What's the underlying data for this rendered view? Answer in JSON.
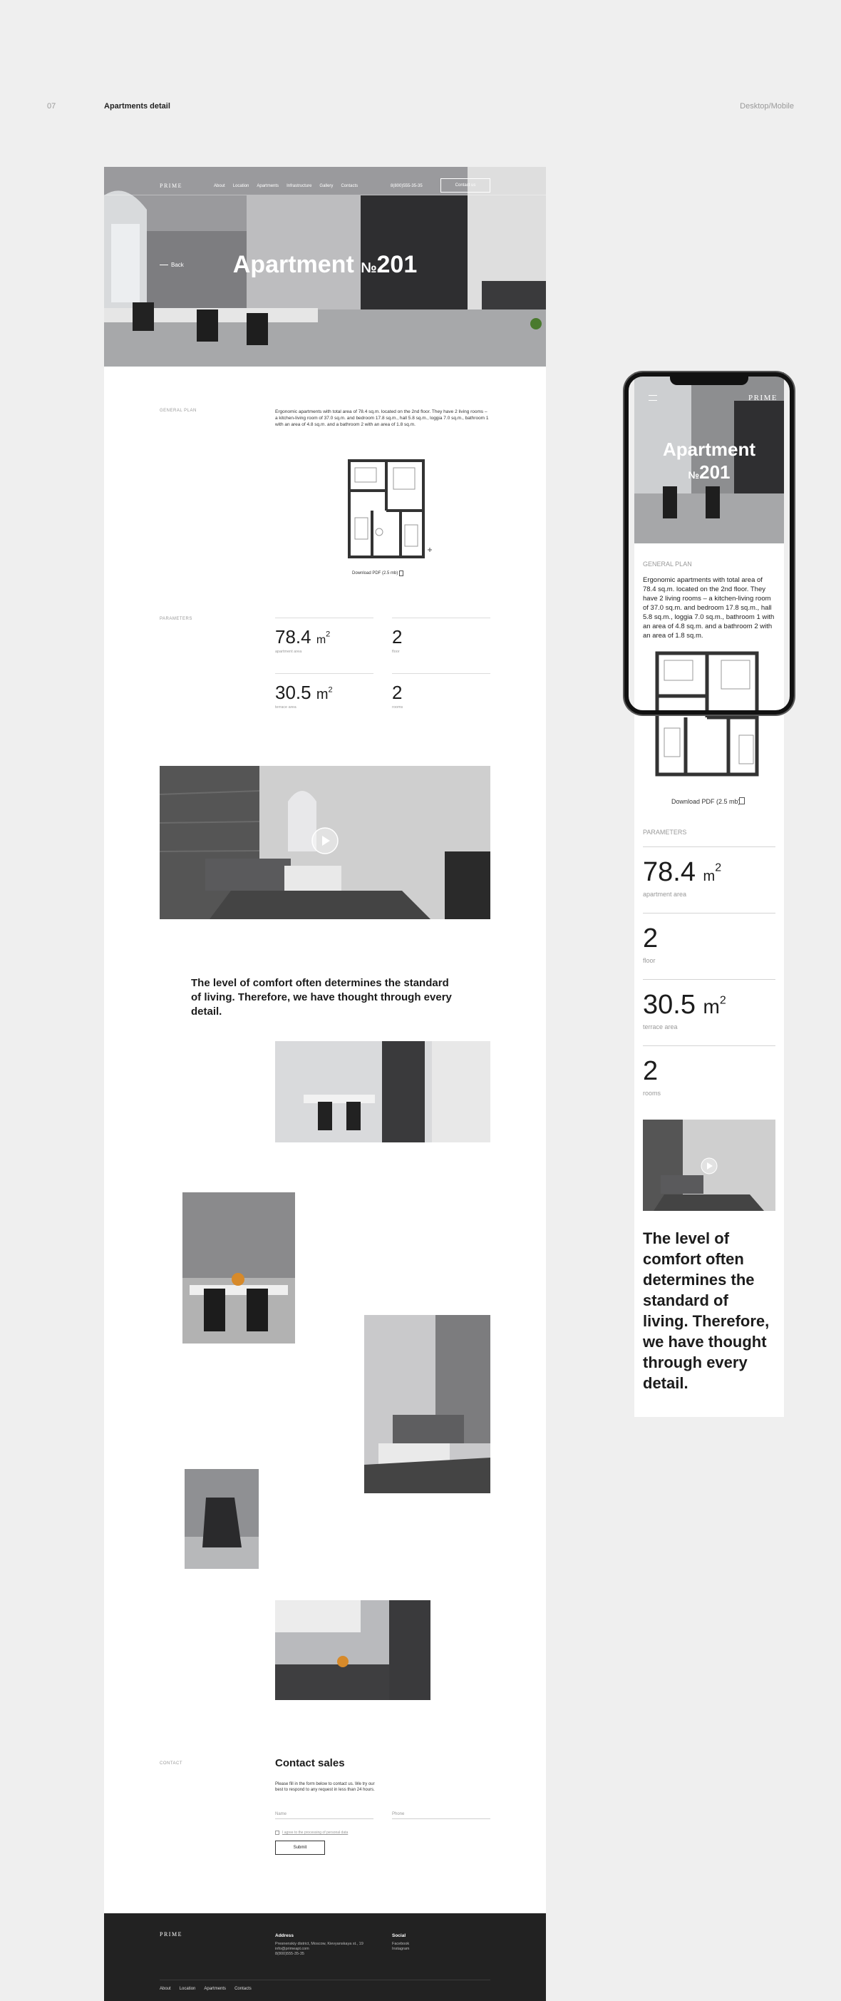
{
  "page": {
    "number": "07",
    "title": "Apartments detail",
    "mode": "Desktop/Mobile"
  },
  "nav": {
    "logo": "PRIME",
    "links": [
      "About",
      "Location",
      "Apartments",
      "Infrastructure",
      "Gallery",
      "Contacts"
    ],
    "phone": "8(800)555-35-35",
    "contact_button": "Contact us"
  },
  "hero": {
    "back": "Back",
    "title": "Apartment ",
    "number_sign": "№",
    "number": "201"
  },
  "plan": {
    "label": "GENERAL PLAN",
    "description": "Ergonomic apartments with total area of 78.4 sq.m. located on the 2nd floor. They have 2 living rooms – a kitchen-living room of 37.0 sq.m. and bedroom 17.8 sq.m., hall 5.8 sq.m., loggia 7.0 sq.m., bathroom 1 with an area of 4.8 sq.m. and a bathroom 2 with an area of 1.8 sq.m.",
    "download": "Download PDF (2.5 mb)"
  },
  "params": {
    "label": "PARAMETERS",
    "items": [
      {
        "value": "78.4",
        "unit": "m",
        "sup": "2",
        "caption": "apartment area"
      },
      {
        "value": "2",
        "unit": "",
        "sup": "",
        "caption": "floor"
      },
      {
        "value": "30.5",
        "unit": "m",
        "sup": "2",
        "caption": "terrace area"
      },
      {
        "value": "2",
        "unit": "",
        "sup": "",
        "caption": "rooms"
      }
    ]
  },
  "quote": "The level of comfort often determines the standard of living. Therefore, we have thought through every detail.",
  "contact": {
    "label": "CONTACT",
    "title": "Contact sales",
    "text": "Please fill in the form below to contact us. We try our best to respond to any request in less than 24 hours.",
    "name_placeholder": "Name",
    "phone_placeholder": "Phone",
    "consent": "I agree to the processing of personal data",
    "submit": "Submit"
  },
  "footer": {
    "logo": "PRIME",
    "address_title": "Address",
    "address_lines": [
      "Presnenskiy district, Moscow, Kievyanskaya st., 19",
      "info@primeapt.com",
      "8(800)555-35-35"
    ],
    "social_title": "Social",
    "social": [
      "Facebook",
      "Instagram"
    ],
    "nav": [
      "About",
      "Location",
      "Apartments",
      "Contacts"
    ]
  },
  "mobile": {
    "logo": "PRIME",
    "hero_title": "Apartment",
    "plan_label": "GENERAL PLAN",
    "download": "Download PDF (2.5 mb)",
    "params_label": "PARAMETERS"
  },
  "colors": {
    "page_bg": "#efefef",
    "dark": "#222222",
    "accent_text": "#1c1c1c"
  }
}
